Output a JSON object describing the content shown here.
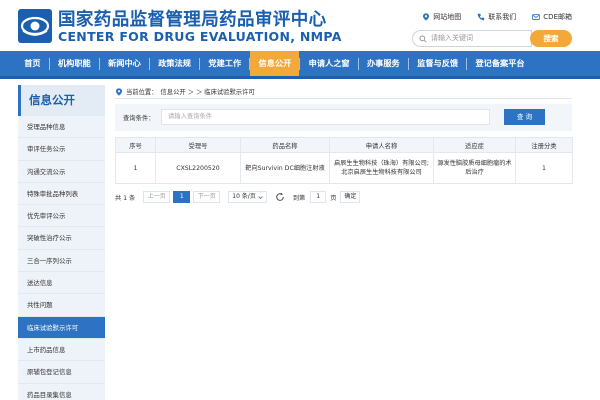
{
  "header": {
    "title_cn": "国家药品监督管理局药品审评中心",
    "title_en": "CENTER FOR DRUG EVALUATION, NMPA",
    "links": {
      "sitemap": "网站地图",
      "contact": "联系我们",
      "mail": "CDE邮箱"
    },
    "search": {
      "placeholder": "请输入关键词",
      "button": "搜索"
    }
  },
  "nav": {
    "items": [
      "首页",
      "机构职能",
      "新闻中心",
      "政策法规",
      "党建工作",
      "信息公开",
      "申请人之窗",
      "办事服务",
      "监督与反馈",
      "登记备案平台"
    ],
    "active_index": 5
  },
  "sidebar": {
    "title": "信息公开",
    "items": [
      "受理品种信息",
      "审评任务公示",
      "沟通交流公示",
      "特殊审批品种列表",
      "优先审评公示",
      "突破性治疗公示",
      "三合一序列公示",
      "送达信息",
      "共性问题",
      "临床试验默示许可",
      "上市药品信息",
      "原辅包登记信息",
      "药品目录集信息"
    ],
    "active_index": 9
  },
  "breadcrumb": {
    "prefix": "当前位置：",
    "path": "信息公开 ＞ ＞ 临床试验默示许可"
  },
  "query": {
    "label": "查询条件：",
    "placeholder": "请输入查询条件",
    "button": "查 询"
  },
  "table": {
    "headers": [
      "序号",
      "受理号",
      "药品名称",
      "申请人名称",
      "适应症",
      "注册分类"
    ],
    "rows": [
      [
        "1",
        "CXSL2200520",
        "靶向Survivin DC细胞注射液",
        "启辰生生物科技（珠海）有限公司;北京启辰生生物科技有限公司",
        "源发性脑胶质母细胞瘤的术后治疗",
        "1"
      ]
    ]
  },
  "pager": {
    "total_prefix": "共 1 条",
    "prev": "上一页",
    "current": "1",
    "next": "下一页",
    "page_size": "10 条/页",
    "goto_label": "到第",
    "goto_value": "1",
    "page_unit": "页",
    "confirm": "确定"
  },
  "colors": {
    "brand_blue": "#2e73c3",
    "title_blue": "#1b5fae",
    "accent_orange": "#f3a93a"
  },
  "icons": {
    "logo": "cde-logo-icon",
    "sitemap": "location-pin-icon",
    "contact": "phone-icon",
    "mail": "mail-icon",
    "search": "search-icon",
    "refresh": "refresh-icon"
  }
}
